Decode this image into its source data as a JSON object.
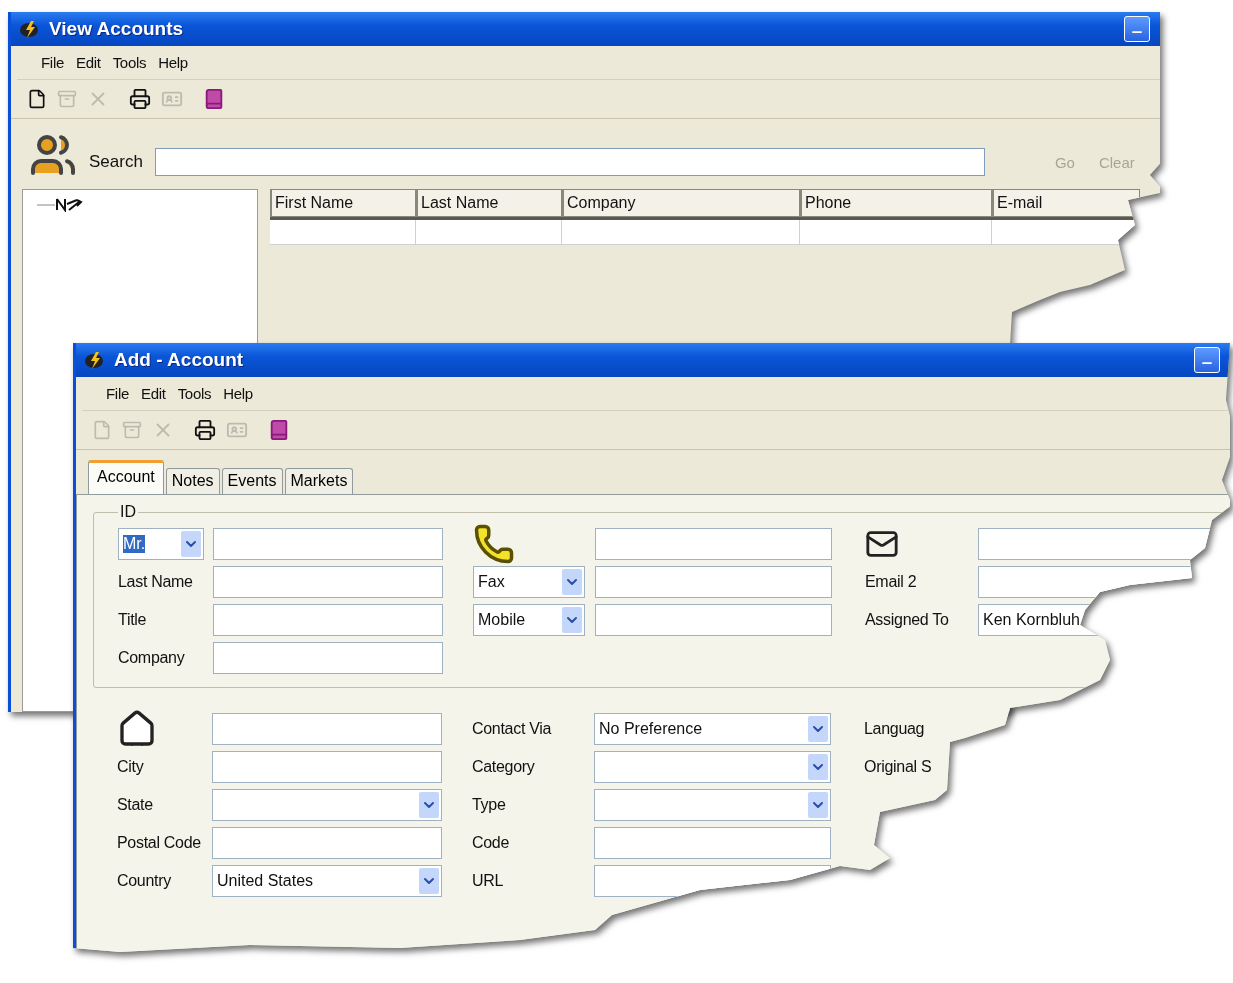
{
  "view_window": {
    "title": "View Accounts",
    "menu": [
      "File",
      "Edit",
      "Tools",
      "Help"
    ],
    "toolbar": [
      {
        "kind": "new",
        "disabled": false
      },
      {
        "kind": "save",
        "disabled": true
      },
      {
        "kind": "delete",
        "disabled": true
      },
      {
        "kind": "print",
        "disabled": false
      },
      {
        "kind": "card",
        "disabled": true
      },
      {
        "kind": "book",
        "disabled": false
      }
    ],
    "search": {
      "label": "Search",
      "buttons": [
        {
          "label": "Go",
          "disabled": true
        },
        {
          "label": "Clear",
          "disabled": true
        }
      ]
    },
    "table": {
      "columns": [
        "First Name",
        "Last Name",
        "Company",
        "Phone",
        "E-mail"
      ]
    }
  },
  "add_window": {
    "title": "Add - Account",
    "menu": [
      "File",
      "Edit",
      "Tools",
      "Help"
    ],
    "toolbar": [
      {
        "kind": "new",
        "disabled": true
      },
      {
        "kind": "save",
        "disabled": true
      },
      {
        "kind": "delete",
        "disabled": true
      },
      {
        "kind": "print",
        "disabled": false
      },
      {
        "kind": "card",
        "disabled": true
      },
      {
        "kind": "book",
        "disabled": false
      }
    ],
    "tabs": [
      {
        "label": "Account",
        "selected": true
      },
      {
        "label": "Notes",
        "selected": false
      },
      {
        "label": "Events",
        "selected": false
      },
      {
        "label": "Markets",
        "selected": false
      }
    ],
    "group_label": "ID",
    "salutation": {
      "value": "Mr.",
      "text_selected": true
    },
    "name_fields": [
      "Last Name",
      "Title",
      "Company"
    ],
    "phones": [
      {
        "kind": "icon"
      },
      {
        "kind": "select",
        "value": "Fax"
      },
      {
        "kind": "select",
        "value": "Mobile"
      }
    ],
    "emails": [
      {
        "kind": "icon"
      },
      {
        "kind": "label",
        "label": "Email 2"
      },
      {
        "kind": "label",
        "label": "Assigned To",
        "value": "Ken Kornbluh"
      }
    ],
    "address": [
      {
        "kind": "icon"
      },
      {
        "kind": "text",
        "label": "City"
      },
      {
        "kind": "select",
        "label": "State"
      },
      {
        "kind": "text",
        "label": "Postal Code"
      },
      {
        "kind": "select",
        "label": "Country",
        "value": "United States"
      }
    ],
    "contact": [
      {
        "kind": "select",
        "label": "Contact Via",
        "value": "No Preference"
      },
      {
        "kind": "select",
        "label": "Category"
      },
      {
        "kind": "select",
        "label": "Type"
      },
      {
        "kind": "text",
        "label": "Code"
      },
      {
        "kind": "text",
        "label": "URL"
      }
    ],
    "extra_labels": [
      "Languag",
      "Original S"
    ]
  }
}
